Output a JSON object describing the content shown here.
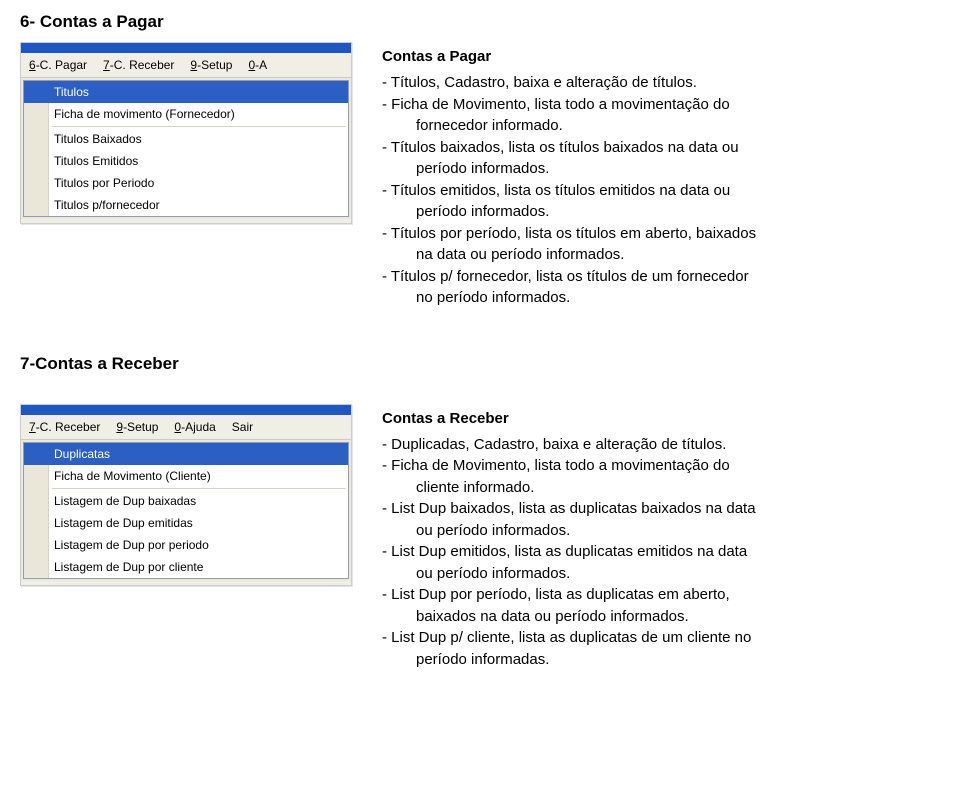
{
  "section1": {
    "heading": "6- Contas a Pagar",
    "menubar": {
      "items": [
        {
          "u": "6",
          "rest": "-C. Pagar"
        },
        {
          "u": "7",
          "rest": "-C. Receber"
        },
        {
          "u": "9",
          "rest": "-Setup"
        },
        {
          "u": "0",
          "rest": "-A"
        }
      ]
    },
    "menu": {
      "highlight": "Titulos",
      "item1": "Ficha de movimento (Fornecedor)",
      "item2": "Titulos Baixados",
      "item3": "Titulos Emitidos",
      "item4": "Titulos por Periodo",
      "item5": "Titulos p/fornecedor"
    },
    "desc": {
      "title": "Contas a Pagar",
      "l1a": "- Títulos, Cadastro, baixa e alteração de títulos.",
      "l2a": "- Ficha de Movimento, lista todo a movimentação do",
      "l2b": "fornecedor informado.",
      "l3a": "- Títulos baixados, lista os títulos baixados na data ou",
      "l3b": "período informados.",
      "l4a": "- Títulos emitidos, lista os títulos emitidos na data ou",
      "l4b": "período informados.",
      "l5a": "- Títulos por período, lista os títulos em aberto, baixados",
      "l5b": "na data ou período informados.",
      "l6a": "- Títulos p/ fornecedor, lista os títulos de um fornecedor",
      "l6b": "no  período informados."
    }
  },
  "section2": {
    "heading": "7-Contas a Receber",
    "menubar": {
      "items": [
        {
          "u": "7",
          "rest": "-C. Receber"
        },
        {
          "u": "9",
          "rest": "-Setup"
        },
        {
          "u": "0",
          "rest": "-Ajuda"
        },
        {
          "u": "",
          "rest": "Sair"
        }
      ]
    },
    "menu": {
      "highlight": "Duplicatas",
      "item1": "Ficha de Movimento (Cliente)",
      "item2": "Listagem de Dup baixadas",
      "item3": "Listagem de Dup emitidas",
      "item4": "Listagem de Dup por periodo",
      "item5": "Listagem de Dup por cliente"
    },
    "desc": {
      "title": "Contas a Receber",
      "l1a": "- Duplicadas, Cadastro, baixa e alteração de títulos.",
      "l2a": "- Ficha de Movimento, lista todo a movimentação do",
      "l2b": "cliente informado.",
      "l3a": "- List Dup baixados, lista as duplicatas baixados na data",
      "l3b": "ou período informados.",
      "l4a": "- List Dup emitidos, lista as duplicatas emitidos na data",
      "l4b": "ou período informados.",
      "l5a": "- List Dup por período, lista as duplicatas em aberto,",
      "l5b": "baixados na data ou período informados.",
      "l6a": "- List Dup p/ cliente, lista as duplicatas de um cliente no",
      "l6b": "período informadas."
    }
  }
}
